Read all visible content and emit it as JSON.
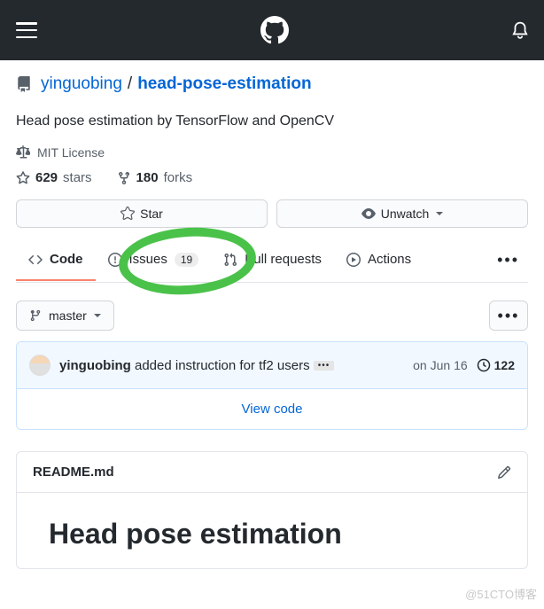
{
  "breadcrumb": {
    "owner": "yinguobing",
    "sep": "/",
    "repo": "head-pose-estimation"
  },
  "repo": {
    "description": "Head pose estimation by TensorFlow and OpenCV",
    "license": "MIT License",
    "stars_count": "629",
    "stars_label": "stars",
    "forks_count": "180",
    "forks_label": "forks"
  },
  "actions": {
    "star_label": "Star",
    "unwatch_label": "Unwatch"
  },
  "tabs": {
    "code": "Code",
    "issues": "Issues",
    "issues_count": "19",
    "pulls": "Pull requests",
    "actions": "Actions"
  },
  "branch": {
    "name": "master"
  },
  "commit": {
    "author": "yinguobing",
    "message": "added instruction for tf2 users",
    "date": "on Jun 16",
    "count": "122",
    "view_code": "View code"
  },
  "readme": {
    "filename": "README.md",
    "title": "Head pose estimation"
  },
  "watermark": "@51CTO博客"
}
